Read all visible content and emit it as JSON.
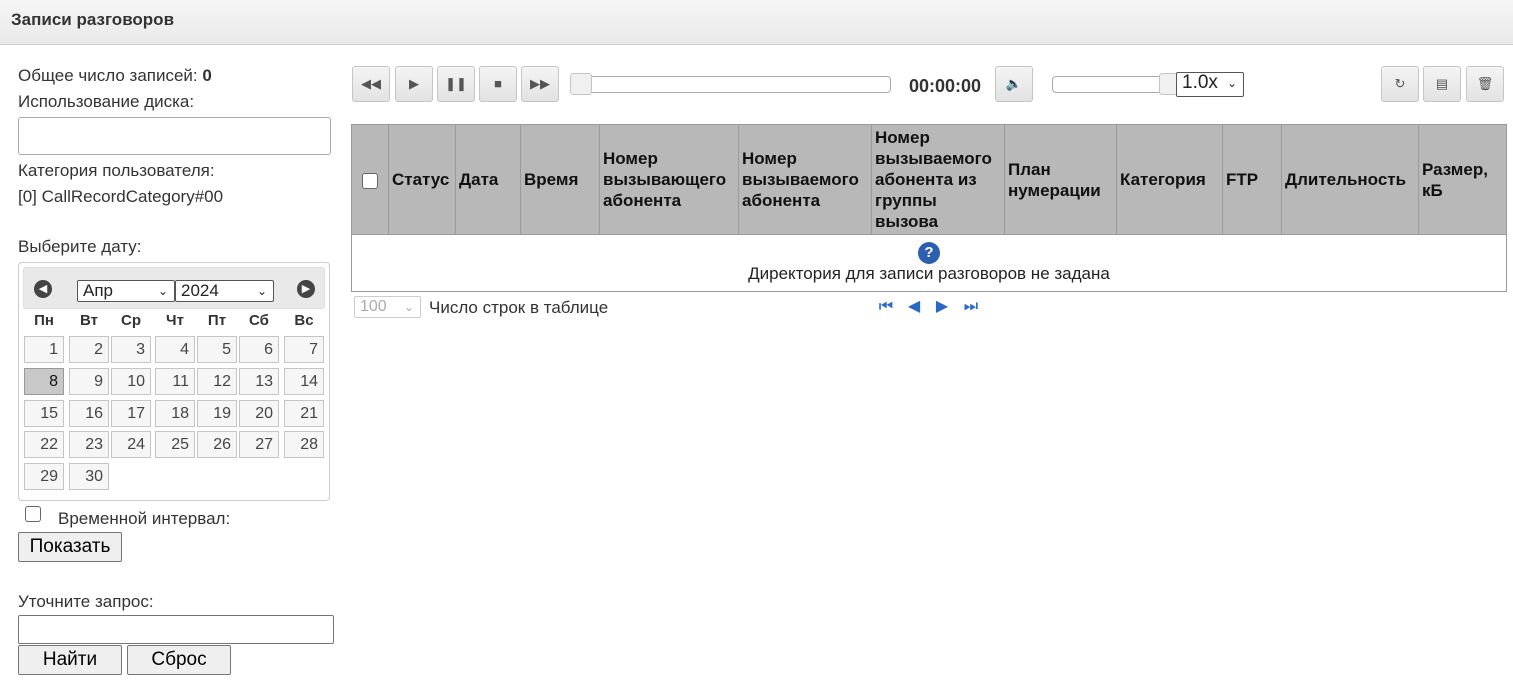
{
  "header": {
    "title": "Записи разговоров"
  },
  "summary": {
    "total_label": "Общее число записей:",
    "total_value": "0",
    "disk_label": "Использование диска:",
    "category_label": "Категория пользователя:",
    "category_value": "[0] CallRecordCategory#00"
  },
  "date": {
    "label": "Выберите дату:",
    "month": "Апр",
    "year": "2024",
    "weekdays": [
      "Пн",
      "Вт",
      "Ср",
      "Чт",
      "Пт",
      "Сб",
      "Вс"
    ],
    "days": [
      "1",
      "2",
      "3",
      "4",
      "5",
      "6",
      "7",
      "8",
      "9",
      "10",
      "11",
      "12",
      "13",
      "14",
      "15",
      "16",
      "17",
      "18",
      "19",
      "20",
      "21",
      "22",
      "23",
      "24",
      "25",
      "26",
      "27",
      "28",
      "29",
      "30"
    ],
    "selected_day": "8"
  },
  "interval_label": "Временной интервал:",
  "show_button": "Показать",
  "refine": {
    "label": "Уточните запрос:",
    "value": "",
    "find_button": "Найти",
    "reset_button": "Сброс"
  },
  "player": {
    "time": "00:00:00",
    "speed": "1.0x",
    "progress": 0,
    "volume": 1.0
  },
  "table": {
    "headers": [
      "Статус",
      "Дата",
      "Время",
      "Номер вызывающего абонента",
      "Номер вызываемого абонента",
      "Номер вызываемого абонента из группы вызова",
      "План нумерации",
      "Категория",
      "FTP",
      "Длительность",
      "Размер, кБ"
    ],
    "empty_message": "Директория для записи разговоров не задана"
  },
  "pager": {
    "rows": "100",
    "rows_label": "Число строк в таблице"
  }
}
